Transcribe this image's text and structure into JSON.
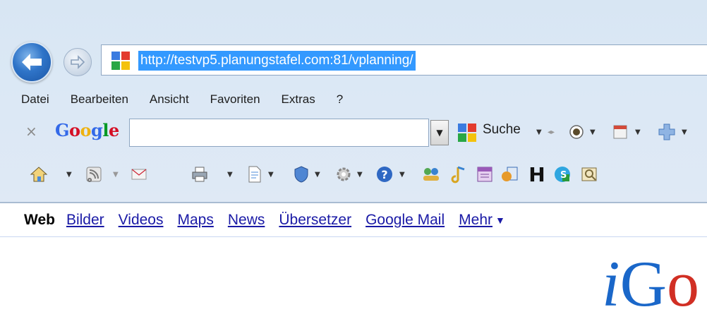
{
  "address_bar": {
    "url": "http://testvp5.planungstafel.com:81/vplanning/"
  },
  "menu": {
    "items": [
      "Datei",
      "Bearbeiten",
      "Ansicht",
      "Favoriten",
      "Extras",
      "?"
    ]
  },
  "google_toolbar": {
    "close_glyph": "×",
    "logo_letters": [
      "G",
      "o",
      "o",
      "g",
      "l",
      "e"
    ],
    "logo_colors": [
      "#3369e8",
      "#d50f25",
      "#eeb211",
      "#3369e8",
      "#009925",
      "#d50f25"
    ],
    "search_value": "",
    "search_button_label": "Suche"
  },
  "toolbar_icons": [
    "home-icon",
    "feeds-icon",
    "mail-icon",
    "print-icon",
    "page-icon",
    "safety-icon",
    "tools-icon",
    "help-icon",
    "messenger-icon",
    "music-icon",
    "calendar-icon",
    "addon-icon",
    "h-icon",
    "skype-icon",
    "scan-icon"
  ],
  "google_nav": {
    "active": "Web",
    "links": [
      "Bilder",
      "Videos",
      "Maps",
      "News",
      "Übersetzer",
      "Google Mail",
      "Mehr"
    ],
    "more_arrow": "▼"
  },
  "page": {
    "logo_i": "i",
    "logo_G": "G",
    "logo_o": "o"
  },
  "colors": {
    "accent_blue": "#1a1aa6",
    "selection": "#3399ff"
  }
}
